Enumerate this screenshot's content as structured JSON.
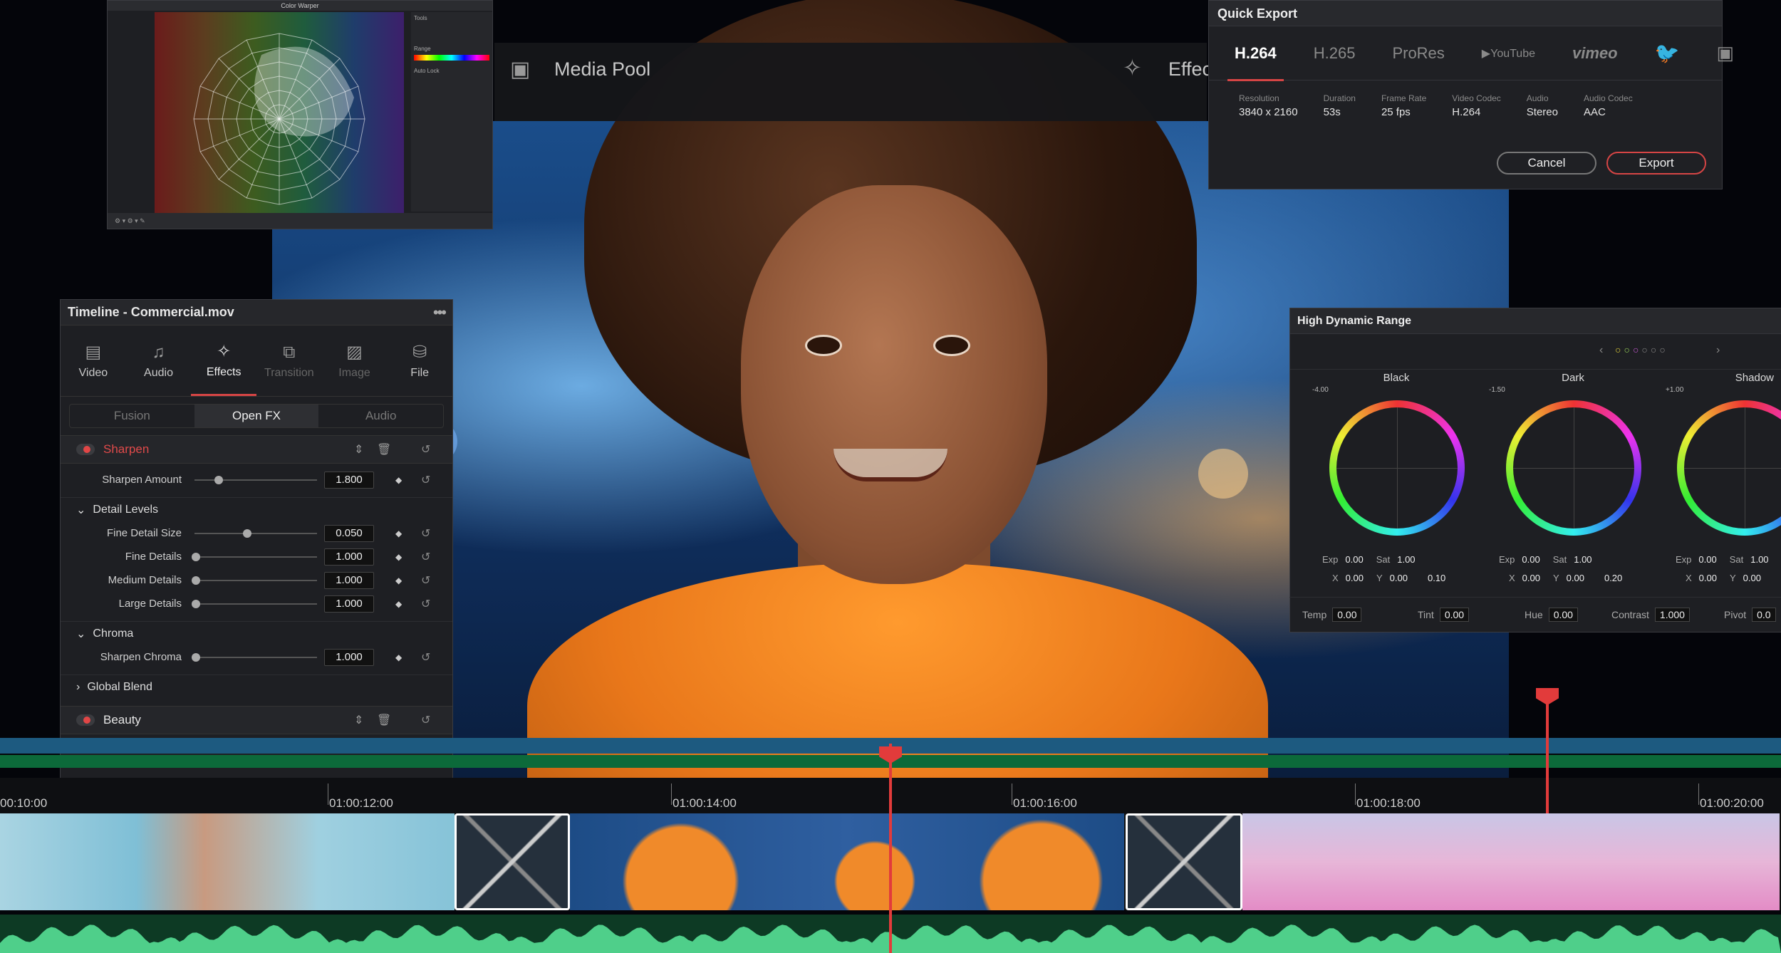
{
  "top_toolbar": {
    "media_pool_label": "Media Pool",
    "effects_label": "Effec"
  },
  "color_warper": {
    "title": "Color Warper",
    "side_labels": [
      "Tools",
      "Range",
      "Auto Lock"
    ]
  },
  "timeline_panel": {
    "title": "Timeline - Commercial.mov",
    "tabs": [
      {
        "label": "Video",
        "icon": "film-icon"
      },
      {
        "label": "Audio",
        "icon": "music-icon"
      },
      {
        "label": "Effects",
        "icon": "magic-wand-icon"
      },
      {
        "label": "Transition",
        "icon": "transition-icon"
      },
      {
        "label": "Image",
        "icon": "image-icon"
      },
      {
        "label": "File",
        "icon": "file-icon"
      }
    ],
    "subtabs": [
      "Fusion",
      "Open FX",
      "Audio"
    ],
    "effect1": {
      "name": "Sharpen",
      "amount_label": "Sharpen Amount",
      "amount_value": "1.800"
    },
    "detail_levels": {
      "title": "Detail Levels",
      "rows": [
        {
          "label": "Fine Detail Size",
          "value": "0.050"
        },
        {
          "label": "Fine Details",
          "value": "1.000"
        },
        {
          "label": "Medium Details",
          "value": "1.000"
        },
        {
          "label": "Large Details",
          "value": "1.000"
        }
      ]
    },
    "chroma": {
      "title": "Chroma",
      "row": {
        "label": "Sharpen Chroma",
        "value": "1.000"
      }
    },
    "global_blend": "Global Blend",
    "effect2": {
      "name": "Beauty"
    }
  },
  "quick_export": {
    "title": "Quick Export",
    "tabs": [
      "H.264",
      "H.265",
      "ProRes",
      "YouTube",
      "vimeo"
    ],
    "meta": [
      {
        "k": "Resolution",
        "v": "3840 x 2160"
      },
      {
        "k": "Duration",
        "v": "53s"
      },
      {
        "k": "Frame Rate",
        "v": "25 fps"
      },
      {
        "k": "Video Codec",
        "v": "H.264"
      },
      {
        "k": "Audio",
        "v": "Stereo"
      },
      {
        "k": "Audio Codec",
        "v": "AAC"
      }
    ],
    "cancel": "Cancel",
    "export": "Export"
  },
  "hdr": {
    "title": "High Dynamic Range",
    "wheels": [
      {
        "name": "Black",
        "num": "-4.00",
        "exp": "0.00",
        "sat": "1.00",
        "x": "0.00",
        "y": "0.00",
        "l": "0.10"
      },
      {
        "name": "Dark",
        "num": "-1.50",
        "exp": "0.00",
        "sat": "1.00",
        "x": "0.00",
        "y": "0.00",
        "l": "0.20"
      },
      {
        "name": "Shadow",
        "num": "+1.00",
        "exp": "0.00",
        "sat": "1.00",
        "x": "0.00",
        "y": "0.00",
        "l": ""
      }
    ],
    "footer": {
      "temp": "0.00",
      "tint": "0.00",
      "hue": "0.00",
      "contrast": "1.000",
      "pivot": "0.0"
    }
  },
  "timeline": {
    "timecodes": [
      "00:10:00",
      "01:00:12:00",
      "01:00:14:00",
      "01:00:16:00",
      "01:00:18:00",
      "01:00:20:00"
    ]
  }
}
